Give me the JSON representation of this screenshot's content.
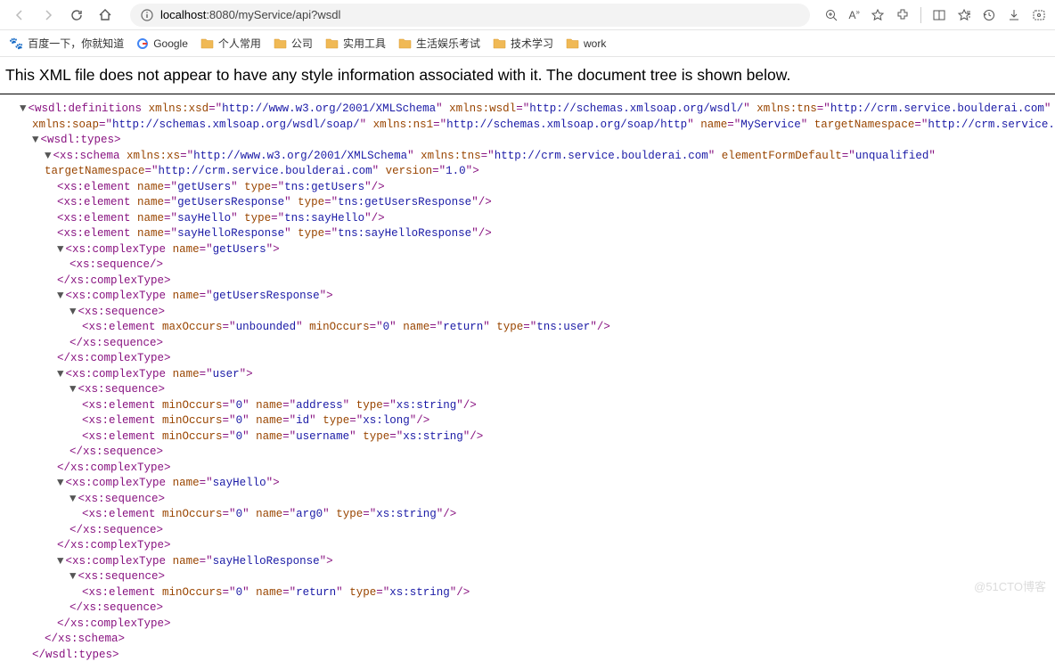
{
  "toolbar": {
    "url_prefix": "localhost",
    "url_rest": ":8080/myService/api?wsdl"
  },
  "bookmarks": [
    {
      "icon": "baidu",
      "label": "百度一下，你就知道"
    },
    {
      "icon": "google",
      "label": "Google"
    },
    {
      "icon": "folder",
      "label": "个人常用"
    },
    {
      "icon": "folder",
      "label": "公司"
    },
    {
      "icon": "folder",
      "label": "实用工具"
    },
    {
      "icon": "folder",
      "label": "生活娱乐考试"
    },
    {
      "icon": "folder",
      "label": "技术学习"
    },
    {
      "icon": "folder",
      "label": "work"
    }
  ],
  "notice": "This XML file does not appear to have any style information associated with it. The document tree is shown below.",
  "xml": {
    "defs_open": "<wsdl:definitions",
    "defs_attrs": [
      {
        "n": "xmlns:xsd",
        "v": "http://www.w3.org/2001/XMLSchema"
      },
      {
        "n": "xmlns:wsdl",
        "v": "http://schemas.xmlsoap.org/wsdl/"
      },
      {
        "n": "xmlns:tns",
        "v": "http://crm.service.boulderai.com"
      },
      {
        "n": "xmlns:soap",
        "v": "http://schemas.xmlsoap.org/wsdl/soap/"
      },
      {
        "n": "xmlns:ns1",
        "v": "http://schemas.xmlsoap.org/soap/http"
      },
      {
        "n": "name",
        "v": "MyService"
      },
      {
        "n": "targetNamespace",
        "v": "http://crm.service.boulderai.com"
      }
    ],
    "types_open": "<wsdl:types>",
    "types_close": "</wsdl:types>",
    "schema_tag": "<xs:schema",
    "schema_attrs": [
      {
        "n": "xmlns:xs",
        "v": "http://www.w3.org/2001/XMLSchema"
      },
      {
        "n": "xmlns:tns",
        "v": "http://crm.service.boulderai.com"
      },
      {
        "n": "elementFormDefault",
        "v": "unqualified"
      },
      {
        "n": "targetNamespace",
        "v": "http://crm.service.boulderai.com"
      },
      {
        "n": "version",
        "v": "1.0"
      }
    ],
    "schema_close": "</xs:schema>",
    "element_tag": "<xs:element",
    "elements_top": [
      {
        "name": "getUsers",
        "type": "tns:getUsers"
      },
      {
        "name": "getUsersResponse",
        "type": "tns:getUsersResponse"
      },
      {
        "name": "sayHello",
        "type": "tns:sayHello"
      },
      {
        "name": "sayHelloResponse",
        "type": "tns:sayHelloResponse"
      }
    ],
    "complex_tag": "<xs:complexType",
    "complex_close": "</xs:complexType>",
    "sequence_open": "<xs:sequence>",
    "sequence_close": "</xs:sequence>",
    "sequence_self": "<xs:sequence/>",
    "complex_types": {
      "getUsers": {
        "name": "getUsers"
      },
      "getUsersResponse": {
        "name": "getUsersResponse",
        "elements": [
          {
            "attrs": [
              {
                "n": "maxOccurs",
                "v": "unbounded"
              },
              {
                "n": "minOccurs",
                "v": "0"
              },
              {
                "n": "name",
                "v": "return"
              },
              {
                "n": "type",
                "v": "tns:user"
              }
            ]
          }
        ]
      },
      "user": {
        "name": "user",
        "elements": [
          {
            "attrs": [
              {
                "n": "minOccurs",
                "v": "0"
              },
              {
                "n": "name",
                "v": "address"
              },
              {
                "n": "type",
                "v": "xs:string"
              }
            ]
          },
          {
            "attrs": [
              {
                "n": "minOccurs",
                "v": "0"
              },
              {
                "n": "name",
                "v": "id"
              },
              {
                "n": "type",
                "v": "xs:long"
              }
            ]
          },
          {
            "attrs": [
              {
                "n": "minOccurs",
                "v": "0"
              },
              {
                "n": "name",
                "v": "username"
              },
              {
                "n": "type",
                "v": "xs:string"
              }
            ]
          }
        ]
      },
      "sayHello": {
        "name": "sayHello",
        "elements": [
          {
            "attrs": [
              {
                "n": "minOccurs",
                "v": "0"
              },
              {
                "n": "name",
                "v": "arg0"
              },
              {
                "n": "type",
                "v": "xs:string"
              }
            ]
          }
        ]
      },
      "sayHelloResponse": {
        "name": "sayHelloResponse",
        "elements": [
          {
            "attrs": [
              {
                "n": "minOccurs",
                "v": "0"
              },
              {
                "n": "name",
                "v": "return"
              },
              {
                "n": "type",
                "v": "xs:string"
              }
            ]
          }
        ]
      }
    }
  },
  "watermark": "@51CTO博客"
}
